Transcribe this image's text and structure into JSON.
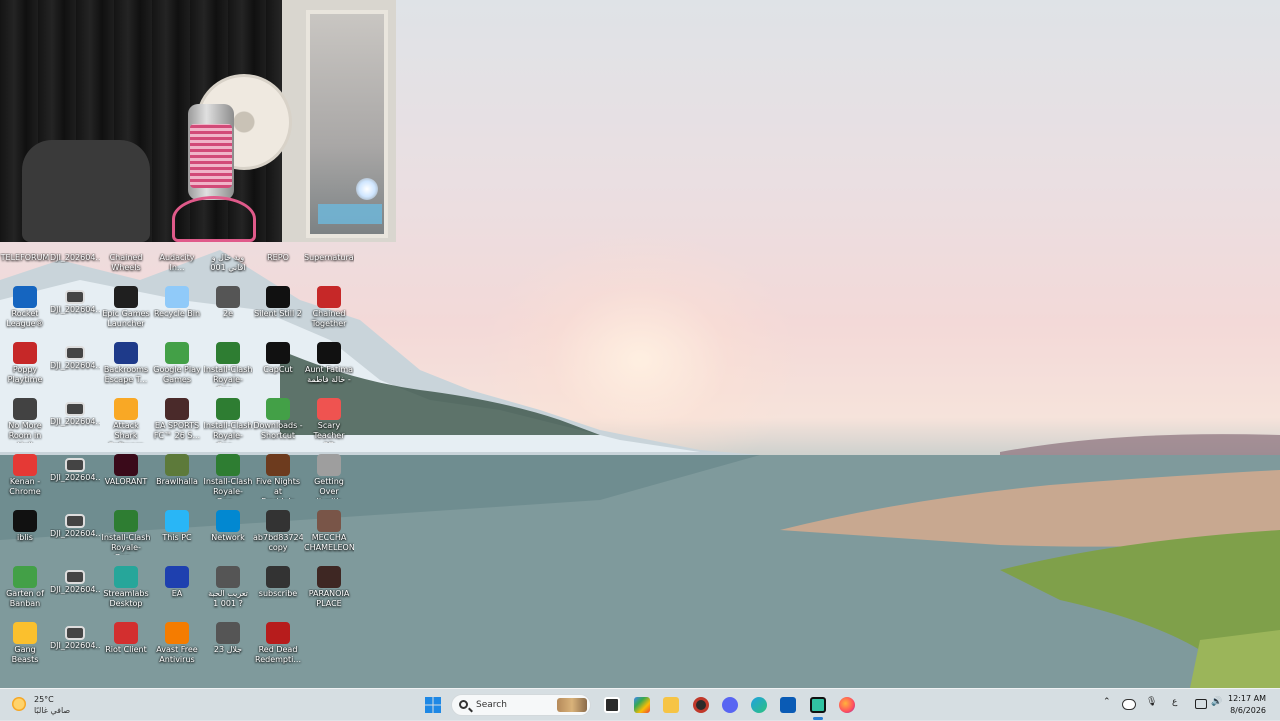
{
  "desktop": {
    "top_row": [
      {
        "label": "TELEFORUM"
      },
      {
        "label": "DJI_202604..."
      },
      {
        "label": "Chained\nWheels"
      },
      {
        "label": "Audacity In..."
      },
      {
        "label": "وية خال و\nاقاني 001"
      },
      {
        "label": "REPO"
      },
      {
        "label": "Supernatural"
      }
    ],
    "col1": [
      {
        "label": "Rocket\nLeague®",
        "icon": "rocket-league-icon",
        "color": "#1565c0"
      },
      {
        "label": "Poppy\nPlaytime",
        "icon": "poppy-playtime-icon",
        "color": "#c62828"
      },
      {
        "label": "No More\nRoom in Hell",
        "icon": "no-more-room-icon",
        "color": "#424242"
      },
      {
        "label": "Kenan -\nChrome",
        "icon": "chrome-icon",
        "color": "#e53935"
      },
      {
        "label": "iblis",
        "icon": "iblis-icon",
        "color": "#111111"
      },
      {
        "label": "Garten of\nBanban",
        "icon": "garten-icon",
        "color": "#43a047"
      },
      {
        "label": "Gang Beasts",
        "icon": "gang-beasts-icon",
        "color": "#fbc02d"
      }
    ],
    "col2": [
      {
        "label": "DJI_202604..."
      },
      {
        "label": "DJI_202604..."
      },
      {
        "label": "DJI_202604..."
      },
      {
        "label": "DJI_202604..."
      },
      {
        "label": "DJI_202604..."
      },
      {
        "label": "DJI_202604..."
      },
      {
        "label": "DJI_202604..."
      }
    ],
    "col3": [
      {
        "label": "Epic Games\nLauncher",
        "icon": "epic-games-icon",
        "color": "#1f1f1f"
      },
      {
        "label": "Backrooms\nEscape T...",
        "icon": "backrooms-icon",
        "color": "#1e3a8a"
      },
      {
        "label": "Attack Shark\nSoftware",
        "icon": "attack-shark-icon",
        "color": "#f9a825"
      },
      {
        "label": "VALORANT",
        "icon": "valorant-icon",
        "color": "#3a0a1a"
      },
      {
        "label": "Install-Clash\nRoyale-Goo...",
        "icon": "install-clash-icon",
        "color": "#2e7d32"
      },
      {
        "label": "Streamlabs\nDesktop",
        "icon": "streamlabs-icon",
        "color": "#26a69a"
      },
      {
        "label": "Riot Client",
        "icon": "riot-client-icon",
        "color": "#d32f2f"
      }
    ],
    "col4": [
      {
        "label": "Recycle Bin",
        "icon": "recycle-bin-icon",
        "color": "#90caf9"
      },
      {
        "label": "Google Play\nGames",
        "icon": "google-play-games-icon",
        "color": "#43a047"
      },
      {
        "label": "EA SPORTS\nFC™ 26 S...",
        "icon": "ea-sports-icon",
        "color": "#4a2a2a"
      },
      {
        "label": "Brawlhalla",
        "icon": "brawlhalla-icon",
        "color": "#5d7a3a"
      },
      {
        "label": "This PC",
        "icon": "this-pc-icon",
        "color": "#29b6f6"
      },
      {
        "label": "EA",
        "icon": "ea-icon",
        "color": "#1e40af"
      },
      {
        "label": "Avast Free\nAntivirus",
        "icon": "avast-icon",
        "color": "#f57c00"
      }
    ],
    "col5": [
      {
        "label": "2e",
        "icon": "video-file-icon",
        "color": "#555555"
      },
      {
        "label": "Install-Clash\nRoyale-Goo...",
        "icon": "install-clash-icon",
        "color": "#2e7d32"
      },
      {
        "label": "Install-Clash\nRoyale-Goo...",
        "icon": "install-clash-icon",
        "color": "#2e7d32"
      },
      {
        "label": "Install-Clash\nRoyale-Goo...",
        "icon": "install-clash-icon",
        "color": "#2e7d32"
      },
      {
        "label": "Network",
        "icon": "network-icon",
        "color": "#0288d1"
      },
      {
        "label": "تعريب الحبة\n1 001 ?",
        "icon": "video-file-icon",
        "color": "#555555"
      },
      {
        "label": "جلال 23",
        "icon": "video-file-icon",
        "color": "#555555"
      }
    ],
    "col6": [
      {
        "label": "Silent Still 2",
        "icon": "silent-still-icon",
        "color": "#111111"
      },
      {
        "label": "CapCut",
        "icon": "capcut-icon",
        "color": "#111111"
      },
      {
        "label": "Downloads -\nShortcut",
        "icon": "downloads-icon",
        "color": "#43a047"
      },
      {
        "label": "Five Nights at\nFreddy's",
        "icon": "fnaf-icon",
        "color": "#6d3b1e"
      },
      {
        "label": "ab7bd83724...\ncopy",
        "icon": "video-file-icon",
        "color": "#333333"
      },
      {
        "label": "subscribe",
        "icon": "video-file-icon",
        "color": "#333333"
      },
      {
        "label": "Red Dead\nRedempti...",
        "icon": "red-dead-icon",
        "color": "#b71c1c"
      }
    ],
    "col7": [
      {
        "label": "Chained\nTogether",
        "icon": "chained-together-icon",
        "color": "#c62828"
      },
      {
        "label": "Aunt Fatima\nخالة فاطمة -",
        "icon": "aunt-fatima-icon",
        "color": "#111111"
      },
      {
        "label": "Scary Teacher\n3D",
        "icon": "scary-teacher-icon",
        "color": "#ef5350"
      },
      {
        "label": "Getting Over\nIt with Ben...",
        "icon": "getting-over-it-icon",
        "color": "#9e9e9e"
      },
      {
        "label": "MECCHA\nCHAMELEON",
        "icon": "meccha-chameleon-icon",
        "color": "#795548"
      },
      {
        "label": "PARANOIA\nPLACE",
        "icon": "paranoia-place-icon",
        "color": "#3e2723"
      },
      {
        "label": "",
        "icon": "",
        "color": ""
      }
    ]
  },
  "taskbar": {
    "weather_temp": "25°C",
    "weather_condition": "صافي غالبًا",
    "search_placeholder": "Search",
    "language": "ع",
    "time": "12:17 AM",
    "date": "8/6/2026"
  }
}
